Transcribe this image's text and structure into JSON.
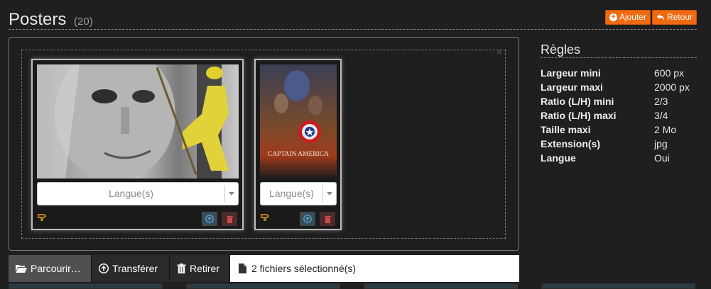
{
  "header": {
    "title": "Posters",
    "count": "(20)",
    "add_label": "Ajouter",
    "back_label": "Retour"
  },
  "posters": [
    {
      "language_placeholder": "Langue(s)",
      "image": "poster-portrait-man-yellow-costume"
    },
    {
      "language_placeholder": "Langue(s)",
      "image": "poster-captain-america"
    }
  ],
  "poster2_title_text": "CAPTAIN AMERICA",
  "rules": {
    "title": "Règles",
    "rows": [
      {
        "label": "Largeur mini",
        "value": "600 px"
      },
      {
        "label": "Largeur maxi",
        "value": "2000 px"
      },
      {
        "label": "Ratio (L/H) mini",
        "value": "2/3"
      },
      {
        "label": "Ratio (L/H) maxi",
        "value": "3/4"
      },
      {
        "label": "Taille maxi",
        "value": "2 Mo"
      },
      {
        "label": "Extension(s)",
        "value": "jpg"
      },
      {
        "label": "Langue",
        "value": "Oui"
      }
    ]
  },
  "actions": {
    "browse": "Parcourir…",
    "transfer": "Transférer",
    "remove": "Retirer",
    "selection": "2 fichiers sélectionné(s)"
  },
  "colors": {
    "accent": "#ef6a10",
    "background": "#1f1f1f"
  },
  "icons": [
    "plus-circle-icon",
    "reply-arrow-icon",
    "close-icon",
    "hand-pointer-icon",
    "upload-icon",
    "trash-icon",
    "folder-open-icon",
    "file-icon"
  ]
}
